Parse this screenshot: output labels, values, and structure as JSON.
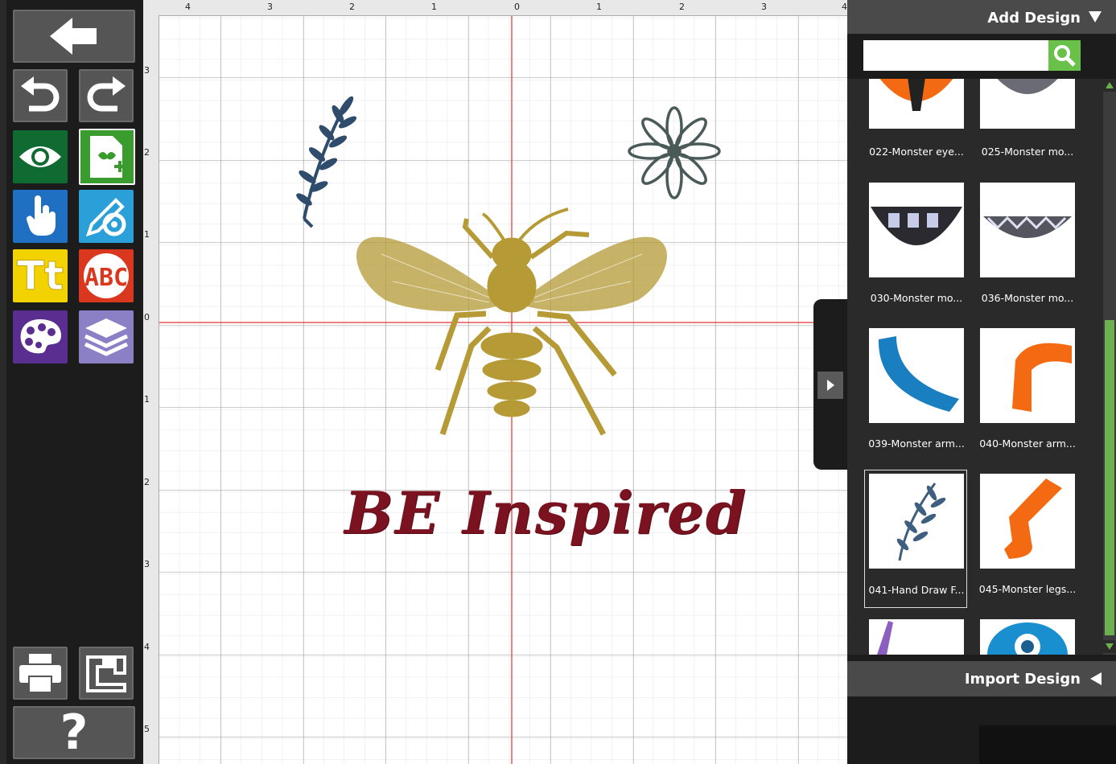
{
  "toolbar": {
    "buttons": [
      {
        "name": "back-button",
        "icon": "arrow-left-icon"
      },
      {
        "name": "undo-button",
        "icon": "undo-icon"
      },
      {
        "name": "redo-button",
        "icon": "redo-icon"
      },
      {
        "name": "preview-button",
        "icon": "eye-icon",
        "color": "#0f6b32"
      },
      {
        "name": "add-design-button",
        "icon": "add-design-icon",
        "color": "#3a9b2e"
      },
      {
        "name": "select-button",
        "icon": "hand-pointer-icon",
        "color": "#1f6fc2"
      },
      {
        "name": "edit-settings-button",
        "icon": "pencil-gear-icon",
        "color": "#2a9fd8"
      },
      {
        "name": "text-button",
        "icon": "text-tt-icon",
        "color": "#f2d200"
      },
      {
        "name": "monogram-button",
        "icon": "monogram-abc-icon",
        "color": "#d9381e"
      },
      {
        "name": "color-button",
        "icon": "palette-icon",
        "color": "#5a2d91"
      },
      {
        "name": "layers-button",
        "icon": "layers-icon",
        "color": "#8b7fc6"
      },
      {
        "name": "print-button",
        "icon": "printer-icon"
      },
      {
        "name": "send-to-machine-button",
        "icon": "sewing-machine-icon"
      },
      {
        "name": "help-button",
        "icon": "question-icon"
      }
    ],
    "text_glyph": "Tt",
    "help_glyph": "?"
  },
  "rulers": {
    "horizontal": [
      "4",
      "3",
      "2",
      "1",
      "0",
      "1",
      "2",
      "3",
      "4"
    ],
    "vertical": [
      "3",
      "2",
      "1",
      "0",
      "1",
      "2",
      "3",
      "4",
      "5"
    ]
  },
  "canvas": {
    "design_text": "BE Inspired",
    "colors": {
      "bee": "#b59a35",
      "leaf": "#2f4c6d",
      "flower": "#4a5a58",
      "text": "#7a1220",
      "axis": "#e53030"
    }
  },
  "panel": {
    "header_label": "Add Design",
    "search": {
      "value": "",
      "placeholder": ""
    },
    "designs": [
      {
        "label": "022-Monster eye...",
        "thumb": "orange-eye-icon"
      },
      {
        "label": "025-Monster mo...",
        "thumb": "gray-mouth-icon"
      },
      {
        "label": "030-Monster mo...",
        "thumb": "black-mouth-icon"
      },
      {
        "label": "036-Monster mo...",
        "thumb": "zigzag-mouth-icon"
      },
      {
        "label": "039-Monster arm...",
        "thumb": "blue-arm-icon"
      },
      {
        "label": "040-Monster arm...",
        "thumb": "orange-arm-icon"
      },
      {
        "label": "041-Hand Draw F...",
        "thumb": "leaf-fern-icon"
      },
      {
        "label": "045-Monster legs...",
        "thumb": "orange-leg-icon"
      }
    ],
    "import_label": "Import Design"
  }
}
